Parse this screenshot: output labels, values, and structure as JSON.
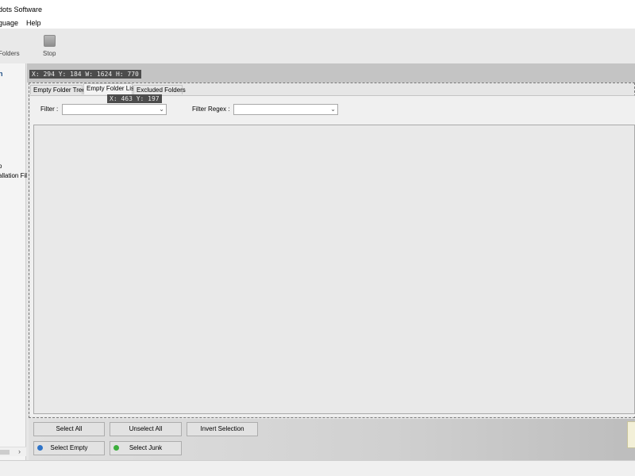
{
  "window": {
    "title": "dots Software"
  },
  "menu": {
    "items": [
      "guage",
      "Help"
    ]
  },
  "toolbar": {
    "folders_label": "Folders",
    "stop_label": "Stop"
  },
  "left_panel": {
    "header": "n",
    "items": [
      "o",
      "allation Fil"
    ]
  },
  "tooltips": {
    "window_info": "X: 294 Y: 184 W: 1624 H: 770",
    "cursor_info": "X: 463 Y: 197"
  },
  "tabs": [
    {
      "label": "Empty Folder Tree",
      "active": false
    },
    {
      "label": "Empty Folder List",
      "active": true
    },
    {
      "label": "Excluded Folders",
      "active": false
    }
  ],
  "filters": {
    "filter_label": "Filter :",
    "filter_value": "",
    "regex_label": "Filter Regex :",
    "regex_value": ""
  },
  "buttons": {
    "select_all": "Select All",
    "unselect_all": "Unselect All",
    "invert_selection": "Invert Selection",
    "select_empty": "Select Empty",
    "select_junk": "Select Junk"
  },
  "icons": {
    "select_empty_dot": "blue-dot-icon",
    "select_junk_dot": "green-dot-icon",
    "combo_arrow": "chevron-down-icon",
    "scroll_right": "chevron-right-icon"
  },
  "colors": {
    "select_empty_dot": "#2f74c8",
    "select_junk_dot": "#3cae3c",
    "tooltip_bg": "#4c4c4c"
  }
}
